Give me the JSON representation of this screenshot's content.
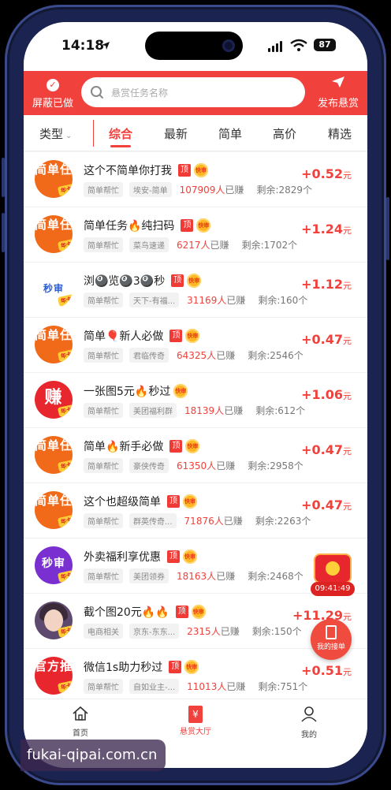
{
  "status_bar": {
    "time": "14:18",
    "battery": "87"
  },
  "header": {
    "hide_done_label": "屏蔽已做",
    "search_placeholder": "悬赏任务名称",
    "publish_label": "发布悬赏"
  },
  "tabs": {
    "type_filter": "类型",
    "items": [
      {
        "label": "综合",
        "active": true
      },
      {
        "label": "最新",
        "active": false
      },
      {
        "label": "简单",
        "active": false
      },
      {
        "label": "高价",
        "active": false
      },
      {
        "label": "精选",
        "active": false
      }
    ]
  },
  "tasks": [
    {
      "avatar": "简单任",
      "title": "这个不简单你打我",
      "tag_top": "顶",
      "tag_fast": "快审",
      "category": "简单帮忙",
      "publisher": "埃安-简单",
      "earned_count": "107909人",
      "earned_label": "已赚",
      "remaining": "剩余:2829个",
      "reward": "+0.52",
      "unit": "元"
    },
    {
      "avatar": "简单任",
      "title": "简单任务🔥纯扫码",
      "tag_top": "顶",
      "tag_fast": "快审",
      "category": "简单帮忙",
      "publisher": "菜鸟速递",
      "earned_count": "6217人",
      "earned_label": "已赚",
      "remaining": "剩余:1702个",
      "reward": "+1.24",
      "unit": "元"
    },
    {
      "avatar": "秒审",
      "title": "浏🎱览🎱3🎱秒",
      "tag_top": "顶",
      "tag_fast": "快审",
      "category": "简单帮忙",
      "publisher": "天下-有福...",
      "earned_count": "31169人",
      "earned_label": "已赚",
      "remaining": "剩余:160个",
      "reward": "+1.12",
      "unit": "元"
    },
    {
      "avatar": "简单任",
      "title": "简单🎈新人必做",
      "tag_top": "顶",
      "tag_fast": "快审",
      "category": "简单帮忙",
      "publisher": "君临传奇",
      "earned_count": "64325人",
      "earned_label": "已赚",
      "remaining": "剩余:2546个",
      "reward": "+0.47",
      "unit": "元"
    },
    {
      "avatar": "赚",
      "title": "一张图5元🔥秒过",
      "tag_top": "",
      "tag_fast": "快审",
      "category": "简单帮忙",
      "publisher": "美团福利群",
      "earned_count": "18139人",
      "earned_label": "已赚",
      "remaining": "剩余:612个",
      "reward": "+1.06",
      "unit": "元"
    },
    {
      "avatar": "简单任",
      "title": "简单🔥新手必做",
      "tag_top": "顶",
      "tag_fast": "快审",
      "category": "简单帮忙",
      "publisher": "豪侠传奇",
      "earned_count": "61350人",
      "earned_label": "已赚",
      "remaining": "剩余:2958个",
      "reward": "+0.47",
      "unit": "元"
    },
    {
      "avatar": "简单任",
      "title": "这个也超级简单",
      "tag_top": "顶",
      "tag_fast": "快审",
      "category": "简单帮忙",
      "publisher": "群英传奇...",
      "earned_count": "71876人",
      "earned_label": "已赚",
      "remaining": "剩余:2263个",
      "reward": "+0.47",
      "unit": "元"
    },
    {
      "avatar": "秒审",
      "title": "外卖福利享优惠",
      "tag_top": "顶",
      "tag_fast": "快审",
      "category": "简单帮忙",
      "publisher": "美团领券",
      "earned_count": "18163人",
      "earned_label": "已赚",
      "remaining": "剩余:2468个",
      "reward": "",
      "unit": ""
    },
    {
      "avatar": "",
      "title": "截个图20元🔥🔥",
      "tag_top": "顶",
      "tag_fast": "快审",
      "category": "电商相关",
      "publisher": "京东-东东...",
      "earned_count": "2315人",
      "earned_label": "已赚",
      "remaining": "剩余:150个",
      "reward": "+11.29",
      "unit": "元"
    },
    {
      "avatar": "官方推",
      "title": "微信1s助力秒过",
      "tag_top": "顶",
      "tag_fast": "快审",
      "category": "简单帮忙",
      "publisher": "自如业主-...",
      "earned_count": "11013人",
      "earned_label": "已赚",
      "remaining": "剩余:751个",
      "reward": "+0.51",
      "unit": "元"
    }
  ],
  "avatar_badge": "年卡",
  "floating": {
    "timer": "09:41:49",
    "my_orders": "我的接单"
  },
  "bottom_nav": [
    {
      "label": "首页"
    },
    {
      "label": "悬赏大厅",
      "icon": "¥"
    },
    {
      "label": "我的"
    }
  ],
  "watermark": "fukai-qipai.com.cn",
  "colors": {
    "brand": "#f0413c",
    "background": "#f3f3f3"
  }
}
